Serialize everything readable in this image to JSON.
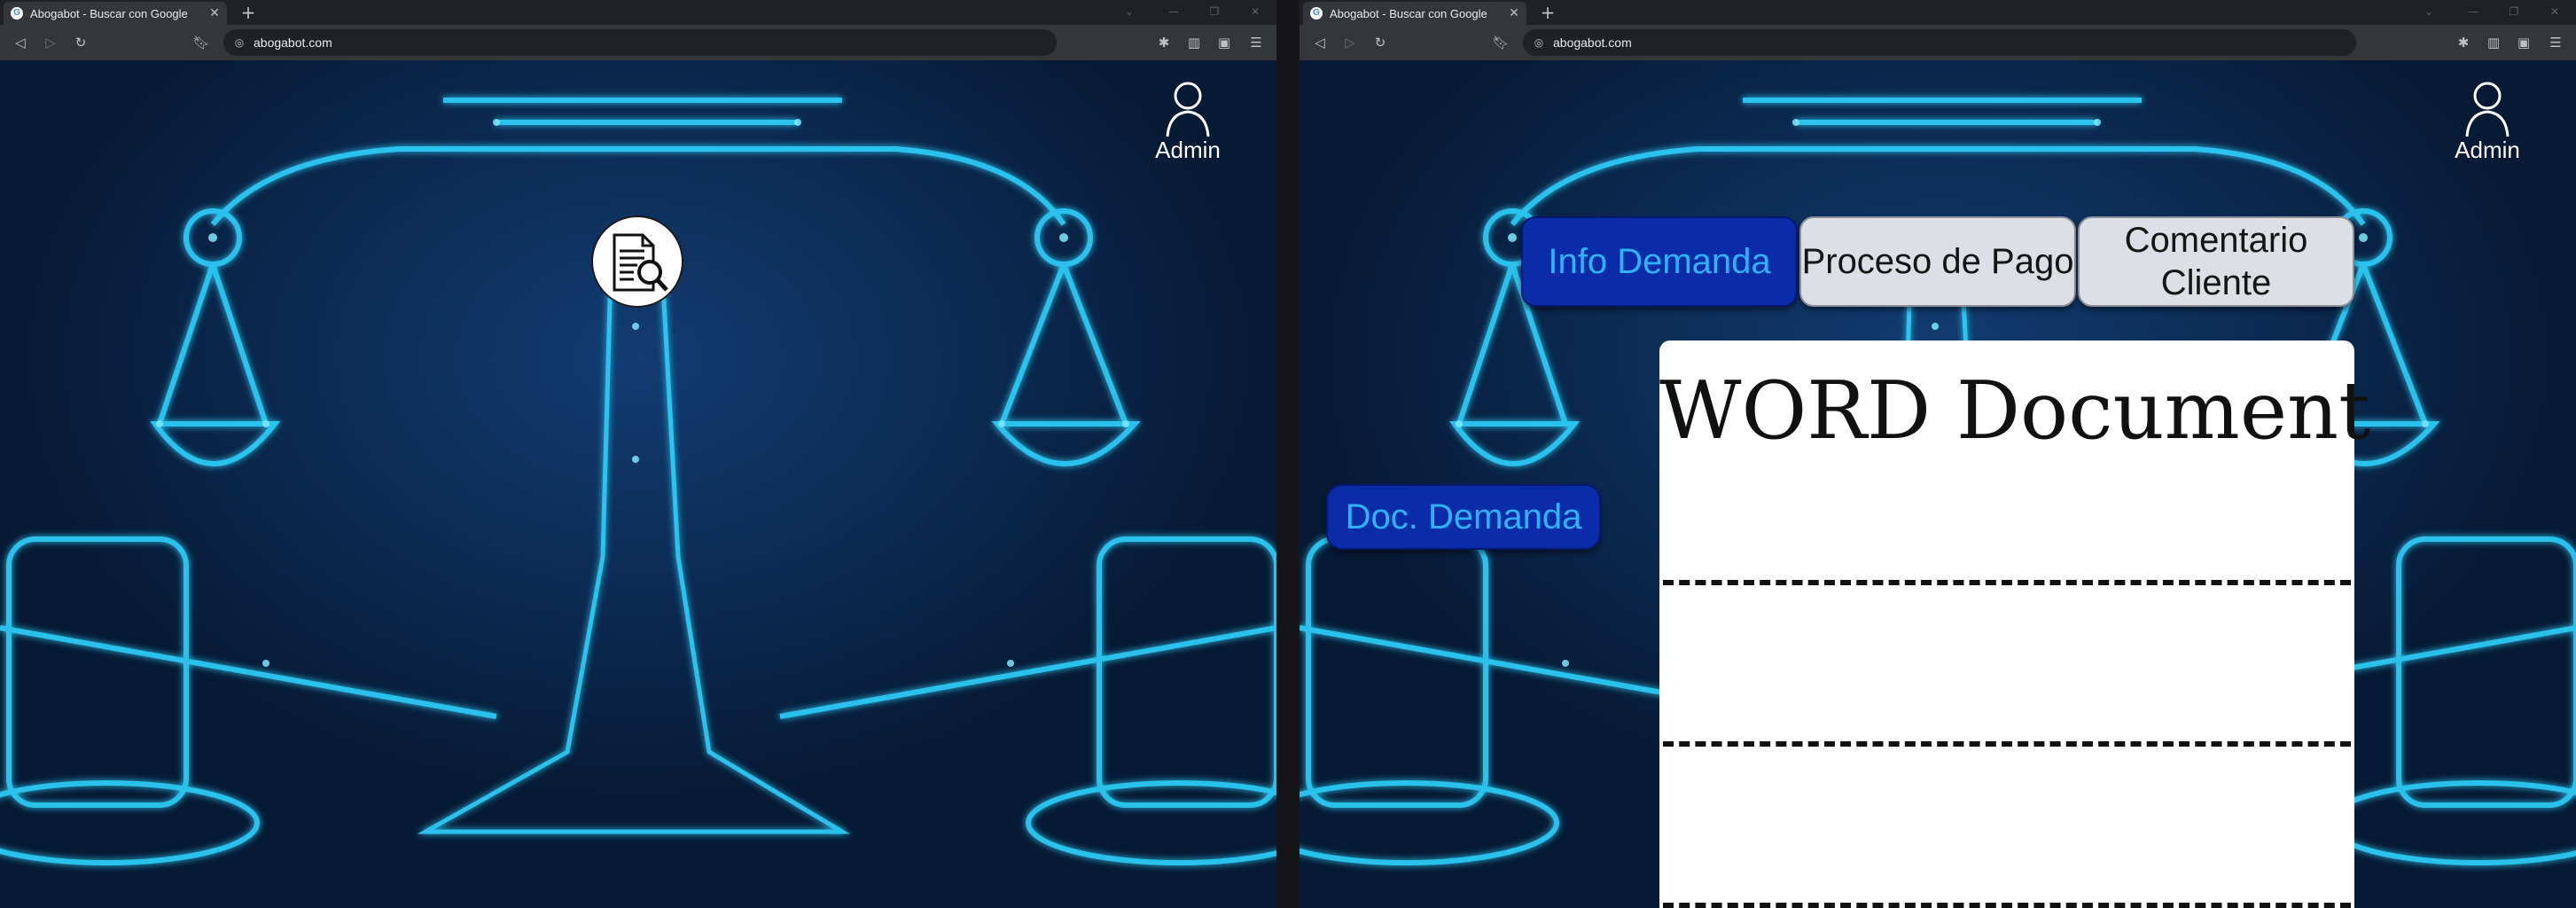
{
  "browser": {
    "tab_title": "Abogabot - Buscar con Google",
    "favicon": "G",
    "close_glyph": "✕",
    "new_tab_glyph": "+",
    "url": "abogabot.com",
    "icons": [
      "back-icon",
      "forward-icon",
      "reload-icon",
      "bookmark-icon",
      "site-info-icon",
      "extensions-icon",
      "side-panel-icon",
      "wallet-icon",
      "menu-icon"
    ]
  },
  "left_screen": {
    "admin_label": "Admin",
    "doc_search_button_icon": "document-search-icon"
  },
  "right_screen": {
    "admin_label": "Admin",
    "tabs": [
      {
        "label": "Info Demanda",
        "active": true
      },
      {
        "label": "Proceso de Pago",
        "active": false
      },
      {
        "label": "Comentario Cliente",
        "active": false
      }
    ],
    "doc_button_label": "Doc. Demanda",
    "document_title": "WORD Document"
  },
  "colors": {
    "active_tab_bg": "#0b2ca8",
    "active_tab_text": "#2fb3ff",
    "idle_tab_bg": "#dcdfe5",
    "background_glow": "#2fd4ff"
  }
}
